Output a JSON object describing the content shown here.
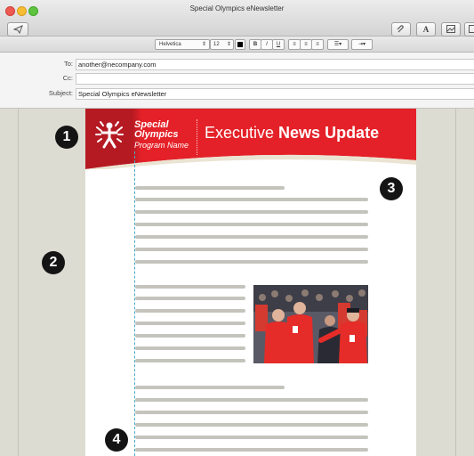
{
  "window": {
    "title": "Special Olympics eNewsletter"
  },
  "toolbar": {
    "send_icon": "send-icon",
    "attach_icon": "paperclip-icon",
    "font_label": "A",
    "photo_icon": "photo-browser-icon"
  },
  "formatbar": {
    "font_family": "Helvetica",
    "font_size": "12",
    "bold": "B",
    "italic": "I",
    "underline": "U"
  },
  "headers": {
    "to_label": "To:",
    "to_value": "another@necompany.com",
    "cc_label": "Cc:",
    "cc_value": "",
    "subject_label": "Subject:",
    "subject_value": "Special Olympics eNewsletter"
  },
  "newsletter": {
    "logo_line1": "Special",
    "logo_line2": "Olympics",
    "program_name": "Program Name",
    "headline_light": "Executive ",
    "headline_bold": "News Update",
    "colors": {
      "banner": "#e42128",
      "banner_dark": "#b51a22",
      "placeholder_text": "#c4c4bd"
    }
  },
  "callouts": [
    "1",
    "2",
    "3",
    "4"
  ]
}
